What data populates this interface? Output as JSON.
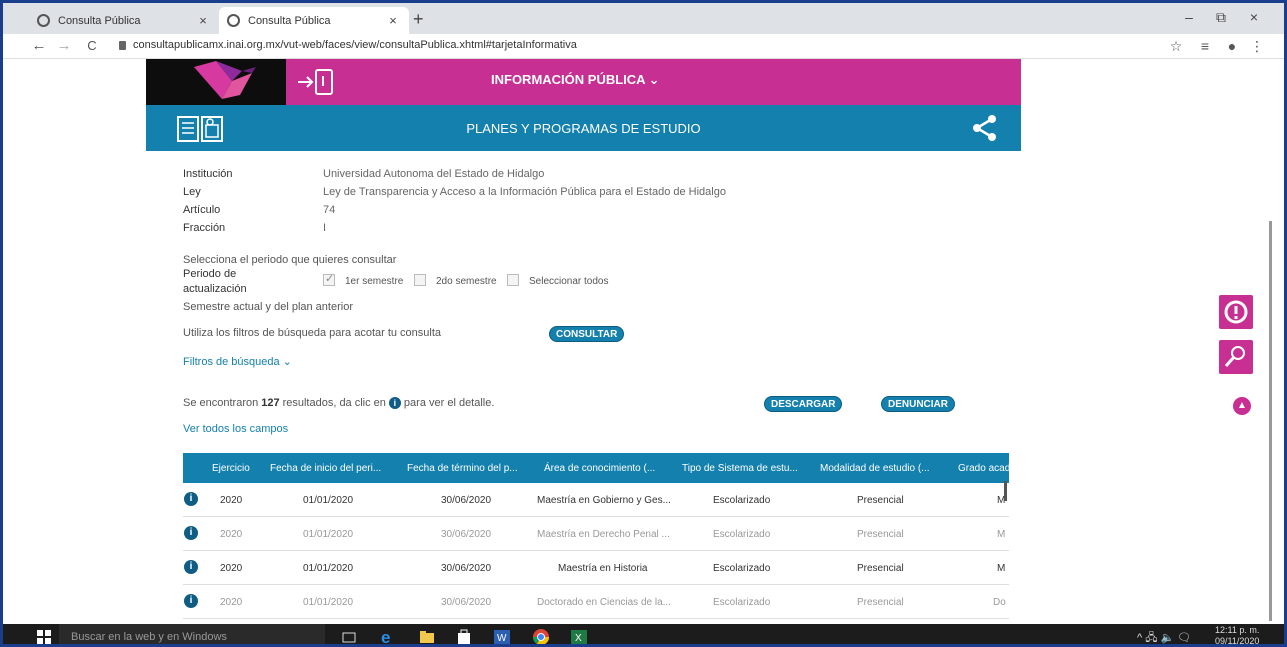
{
  "browser": {
    "tabs": [
      {
        "title": "Consulta Pública",
        "close": "×"
      },
      {
        "title": "Consulta Pública",
        "close": "×"
      }
    ],
    "new_tab": "+",
    "window_controls": {
      "minimize": "–",
      "restore": "⧉",
      "close": "×"
    },
    "nav": {
      "back": "←",
      "forward": "→",
      "reload": "C"
    },
    "url": "consultapublicamx.inai.org.mx/vut-web/faces/view/consultaPublica.xhtml#tarjetaInformativa",
    "toolbar": {
      "star": "☆",
      "reading_list": "≡",
      "profile": "●",
      "menu": "⋮"
    }
  },
  "header": {
    "menu_label": "INFORMACIÓN PÚBLICA ⌄",
    "section_title": "PLANES Y PROGRAMAS DE ESTUDIO",
    "brand_color": "#c82f92",
    "accent_color": "#1480ad"
  },
  "details": [
    {
      "label": "Institución",
      "value": "Universidad Autonoma del Estado de Hidalgo"
    },
    {
      "label": "Ley",
      "value": "Ley de Transparencia y Acceso a la Información Pública para el Estado de Hidalgo"
    },
    {
      "label": "Artículo",
      "value": "74"
    },
    {
      "label": "Fracción",
      "value": "I"
    }
  ],
  "period": {
    "prompt": "Selecciona el periodo que quieres consultar",
    "label_line1": "Periodo de",
    "label_line2": "actualización",
    "options": [
      {
        "label": "1er semestre",
        "checked": true
      },
      {
        "label": "2do semestre",
        "checked": false
      },
      {
        "label": "Seleccionar todos",
        "checked": false
      }
    ],
    "note": "Semestre actual y del plan anterior"
  },
  "filters": {
    "hint": "Utiliza los filtros de búsqueda para acotar tu consulta",
    "consult_button": "CONSULTAR",
    "toggle": "Filtros de búsqueda ⌄"
  },
  "results": {
    "prefix": "Se encontraron",
    "count": "127",
    "suffix": "resultados, da clic en",
    "suffix2": "para ver el detalle.",
    "download_button": "DESCARGAR",
    "report_button": "DENUNCIAR",
    "view_all": "Ver todos los campos"
  },
  "table": {
    "headers": [
      "Ejercicio",
      "Fecha de inicio del peri...",
      "Fecha de término del p...",
      "Área de conocimiento (...",
      "Tipo de Sistema de estu...",
      "Modalidad de estudio (...",
      "Grado acad"
    ],
    "rows": [
      {
        "ejercicio": "2020",
        "inicio": "01/01/2020",
        "termino": "30/06/2020",
        "area": "Maestría en Gobierno y Ges...",
        "sistema": "Escolarizado",
        "modalidad": "Presencial",
        "grado": "M",
        "dim": false
      },
      {
        "ejercicio": "2020",
        "inicio": "01/01/2020",
        "termino": "30/06/2020",
        "area": "Maestría en Derecho Penal ...",
        "sistema": "Escolarizado",
        "modalidad": "Presencial",
        "grado": "M",
        "dim": true
      },
      {
        "ejercicio": "2020",
        "inicio": "01/01/2020",
        "termino": "30/06/2020",
        "area": "Maestría en Historia",
        "sistema": "Escolarizado",
        "modalidad": "Presencial",
        "grado": "M",
        "dim": false
      },
      {
        "ejercicio": "2020",
        "inicio": "01/01/2020",
        "termino": "30/06/2020",
        "area": "Doctorado en Ciencias de la...",
        "sistema": "Escolarizado",
        "modalidad": "Presencial",
        "grado": "Do",
        "dim": true
      }
    ]
  },
  "side": {
    "alert": "!",
    "tools": "🔧",
    "up": "▲"
  },
  "taskbar": {
    "search_placeholder": "Buscar en la web y en Windows",
    "tray": "^ 🖧 🔈 🗨",
    "time": "12:11 p. m.",
    "date": "09/11/2020"
  }
}
